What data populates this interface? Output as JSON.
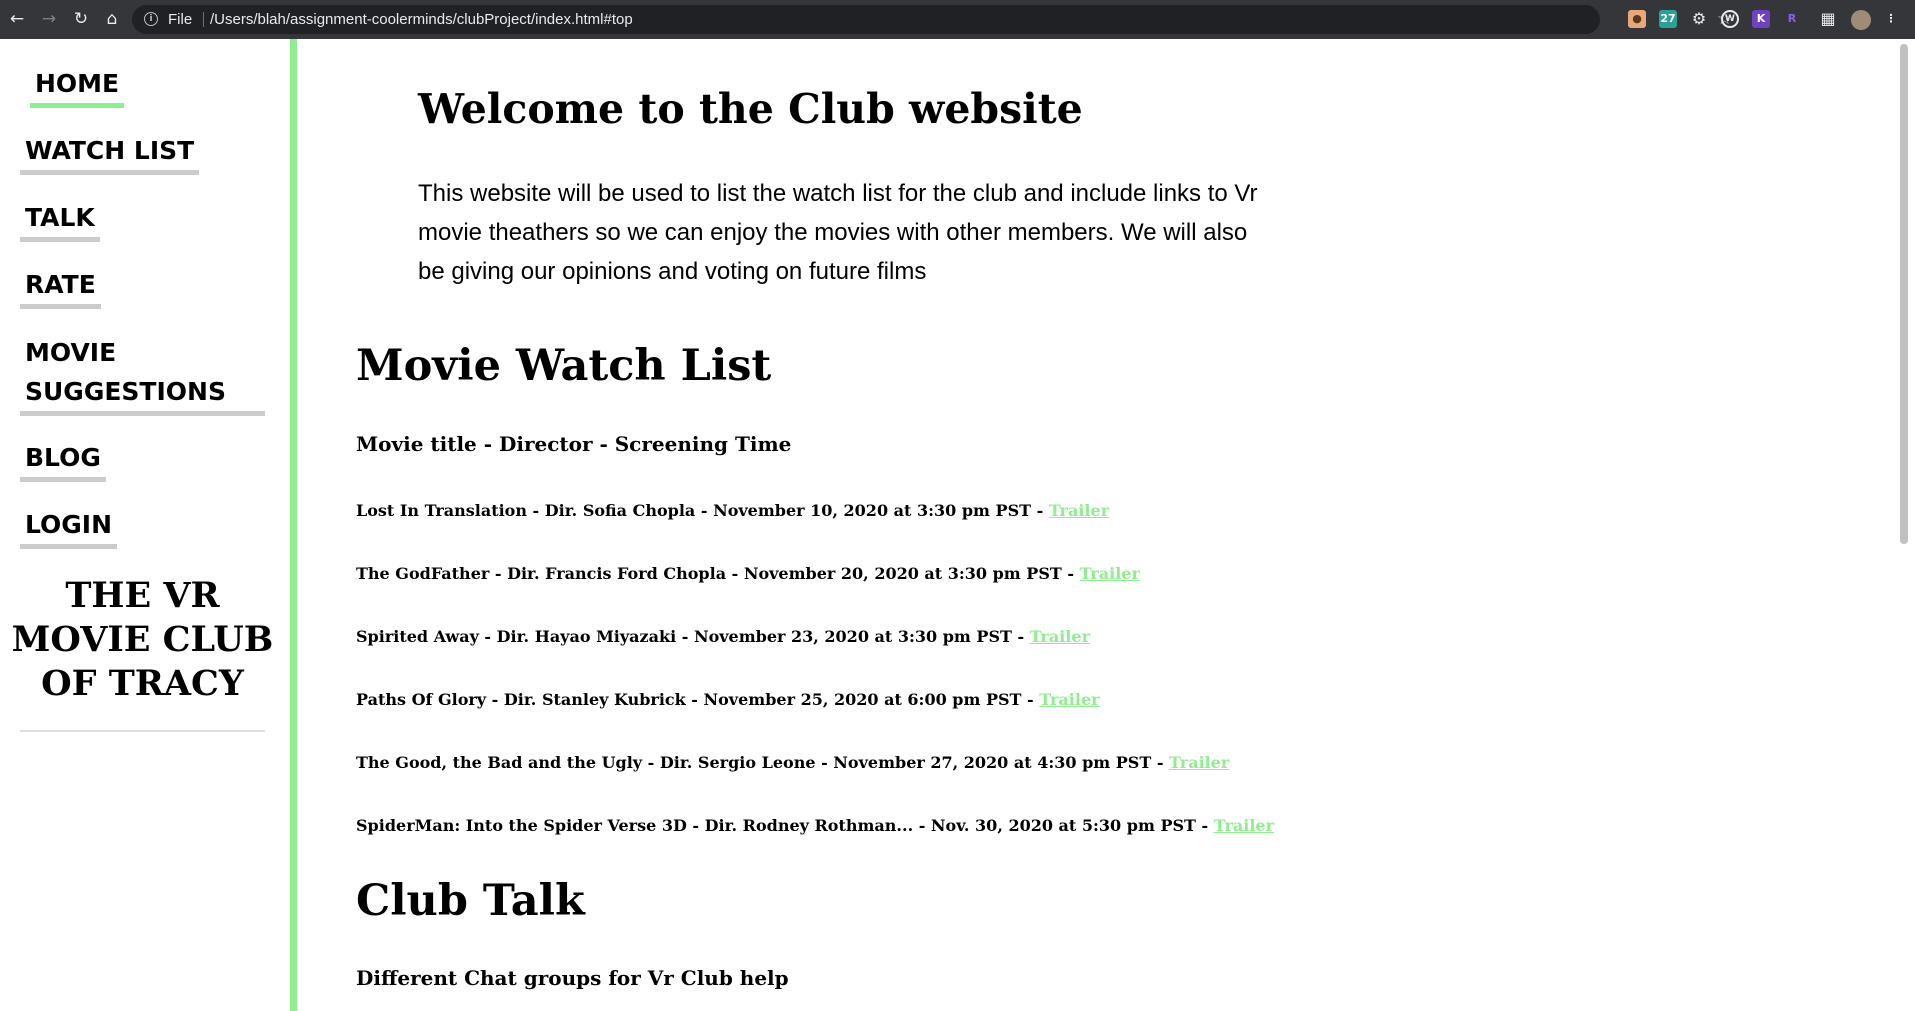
{
  "browser": {
    "file_label": "File",
    "url": "/Users/blah/assignment-coolerminds/clubProject/index.html#top",
    "ext_badge_2": "27",
    "ext_badge_5": "R"
  },
  "sidebar": {
    "items": [
      {
        "label": "HOME"
      },
      {
        "label": "WATCH LIST"
      },
      {
        "label": "TALK"
      },
      {
        "label": "RATE"
      },
      {
        "label": "MOVIE SUGGESTIONS"
      },
      {
        "label": "BLOG"
      },
      {
        "label": "LOGIN"
      }
    ],
    "club_name": "THE VR MOVIE CLUB OF TRACY"
  },
  "main": {
    "welcome_title": "Welcome to the Club website",
    "welcome_text": "This website will be used to list the watch list for the club and include links to Vr movie theathers so we can enjoy the movies with other members. We will also be giving our opinions and voting on future films",
    "watch_list_title": "Movie Watch List",
    "watch_list_header": "Movie title - Director - Screening Time",
    "movies": [
      {
        "text": "Lost In Translation - Dir. Sofia Chopla - November 10, 2020 at 3:30 pm PST - ",
        "link": "Trailer"
      },
      {
        "text": "The GodFather - Dir. Francis Ford Chopla - November 20, 2020 at 3:30 pm PST - ",
        "link": "Trailer"
      },
      {
        "text": "Spirited Away - Dir. Hayao Miyazaki - November 23, 2020 at 3:30 pm PST - ",
        "link": "Trailer"
      },
      {
        "text": "Paths Of Glory - Dir. Stanley Kubrick - November 25, 2020 at 6:00 pm PST - ",
        "link": "Trailer"
      },
      {
        "text": "The Good, the Bad and the Ugly - Dir. Sergio Leone - November 27, 2020 at 4:30 pm PST - ",
        "link": "Trailer"
      },
      {
        "text": "SpiderMan: Into the Spider Verse 3D - Dir. Rodney Rothman... - Nov. 30, 2020 at 5:30 pm PST - ",
        "link": "Trailer"
      }
    ],
    "club_talk_title": "Club Talk",
    "club_talk_header": "Different Chat groups for Vr Club help"
  },
  "colors": {
    "accent": "#90ee90",
    "underline_gray": "#cccccc",
    "chrome_bg": "#35363a"
  }
}
